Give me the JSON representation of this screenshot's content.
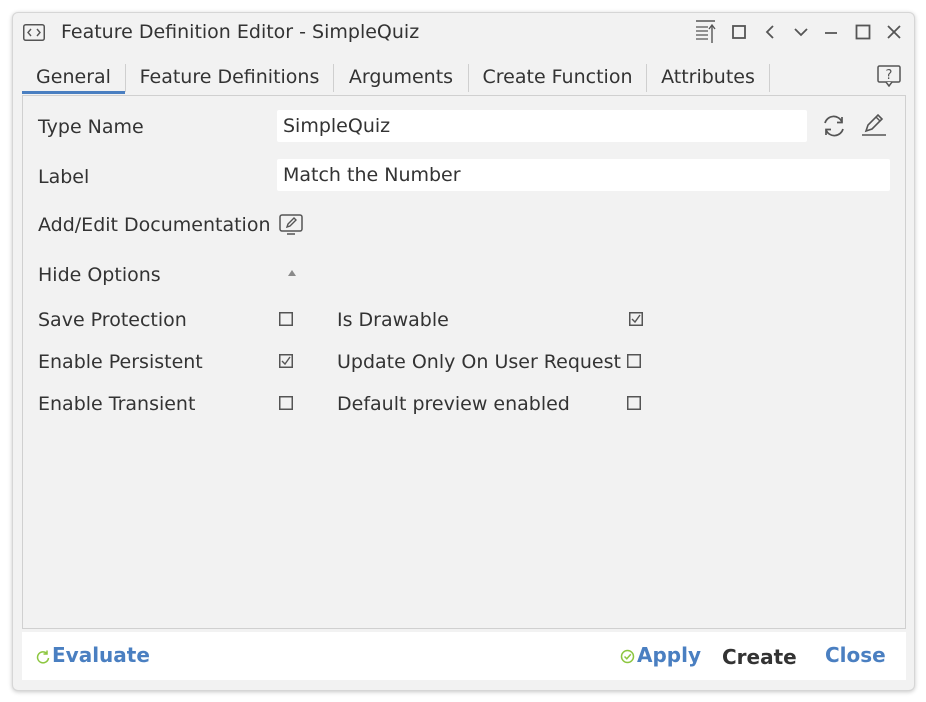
{
  "window": {
    "title": "Feature Definition Editor - SimpleQuiz"
  },
  "tabs": [
    {
      "label": "General",
      "active": true
    },
    {
      "label": "Feature Definitions",
      "active": false
    },
    {
      "label": "Arguments",
      "active": false
    },
    {
      "label": "Create Function",
      "active": false
    },
    {
      "label": "Attributes",
      "active": false
    }
  ],
  "general": {
    "type_name_label": "Type Name",
    "type_name_value": "SimpleQuiz",
    "label_label": "Label",
    "label_value": "Match the Number",
    "documentation_label": "Add/Edit Documentation",
    "options_toggle_label": "Hide Options",
    "options": [
      {
        "label": "Save Protection",
        "checked": false
      },
      {
        "label": "Enable Persistent",
        "checked": true
      },
      {
        "label": "Enable Transient",
        "checked": false
      },
      {
        "label": "Is Drawable",
        "checked": true
      },
      {
        "label": "Update Only On User Request",
        "checked": false
      },
      {
        "label": "Default preview enabled",
        "checked": false
      }
    ]
  },
  "footer": {
    "evaluate": "Evaluate",
    "apply": "Apply",
    "create": "Create",
    "close": "Close"
  },
  "colors": {
    "accent": "#4a7fc1",
    "apply_check": "#8cc63f",
    "window_bg": "#f2f2f2"
  }
}
